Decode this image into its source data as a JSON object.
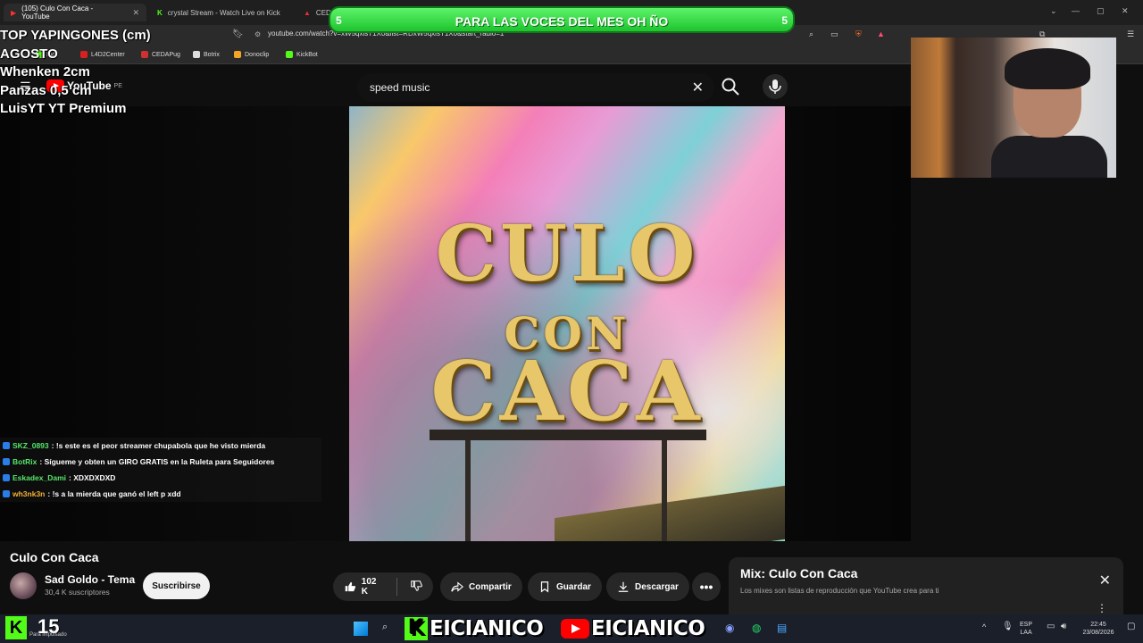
{
  "browser": {
    "tabs": [
      {
        "label": "(105) Culo Con Caca - YouTube",
        "active": true
      },
      {
        "label": "crystal Stream - Watch Live on Kick",
        "active": false
      },
      {
        "label": "CEDA",
        "active": false
      }
    ],
    "url": "youtube.com/watch?v=xW5qxlsT1X0&list=RDxW5qxlsT1X0&start_radio=1",
    "bookmarks": [
      "Kick",
      "L4D2Center",
      "CEDAPug",
      "Botrix",
      "Donoclip",
      "KickBot"
    ]
  },
  "youtube": {
    "logo_text": "YouTube",
    "logo_region": "PE",
    "search": {
      "value": "speed music"
    }
  },
  "video": {
    "sign_lines": [
      "CULO",
      "CON",
      "CACA"
    ],
    "title": "Culo Con Caca",
    "channel": {
      "name": "Sad Goldo - Tema",
      "subscribers": "30,4 K suscriptores"
    },
    "subscribe_label": "Suscribirse",
    "likes": "102 K",
    "share_label": "Compartir",
    "save_label": "Guardar",
    "download_label": "Descargar"
  },
  "mix": {
    "title": "Mix: Culo Con Caca",
    "subtitle": "Los mixes son listas de reproducción que YouTube crea para ti"
  },
  "overlay": {
    "banner": {
      "text": "PARA LAS VOCES DEL MES OH ÑO",
      "left_num": "5",
      "right_num": "5"
    },
    "leaderboard": [
      "TOP YAPINGONES (cm)",
      "AGOSTO",
      "Whenken 2cm",
      "Panzas 0,5 cm",
      "LuisYT YT Premium"
    ],
    "chat": [
      {
        "user": "SKZ_0893",
        "message": ": !s este es el peor streamer chupabola que he visto mierda"
      },
      {
        "user": "BotRix",
        "message": ": Sígueme y obten un GIRO GRATIS en la Ruleta para Seguidores"
      },
      {
        "user": "Eskadex_Dami",
        "message": ": XDXDXDXD"
      },
      {
        "user": "wh3nk3n",
        "message": ": !s a la mierda que ganó el left p xdd"
      }
    ],
    "kick_count": "15",
    "kick_sub": "Para impulsado",
    "brand_name": "EICIANICO"
  },
  "taskbar": {
    "lang": "ESP",
    "lang_sub": "LAA",
    "time": "22:45",
    "date": "23/08/2026"
  },
  "colors": {
    "banner_green": "#1ec42e",
    "kick_green": "#53fc18",
    "youtube_red": "#ff0000"
  }
}
